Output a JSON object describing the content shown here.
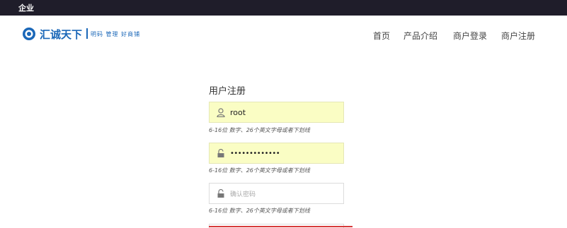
{
  "topbar": {
    "title": "企业"
  },
  "logo": {
    "name": "汇诚天下",
    "slogan": "明码 管理 好商铺",
    "icon": "logo-ring-icon",
    "brand_color": "#1a67b8"
  },
  "nav": {
    "items": [
      {
        "label": "首页"
      },
      {
        "label": "产品介绍"
      },
      {
        "label": "商户登录"
      },
      {
        "label": "商户注册"
      }
    ]
  },
  "form": {
    "title": "用户注册",
    "username": {
      "value": "root",
      "icon": "user-icon"
    },
    "password": {
      "value": "•••••••••••••",
      "icon": "lock-icon"
    },
    "confirm_password": {
      "placeholder": "确认密码",
      "icon": "lock-icon"
    },
    "hints": [
      "6-16位 数字、26个英文字母或者下划线",
      "6-16位 数字、26个英文字母或者下划线",
      "6-16位 数字、26个英文字母或者下划线"
    ],
    "colors": {
      "autofill_bg": "#fafdc4",
      "accent_red": "#d63a3a"
    }
  }
}
